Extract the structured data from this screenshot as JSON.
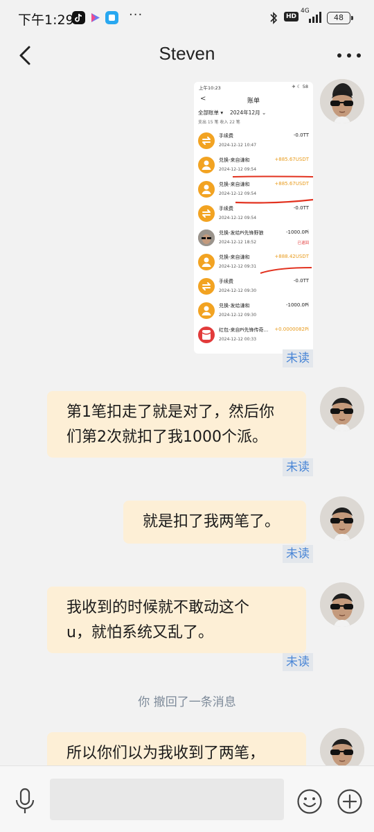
{
  "status_bar": {
    "time": "下午1:29",
    "network": "4G",
    "hd": "HD",
    "battery": "48",
    "more_dots": "···"
  },
  "header": {
    "title": "Steven"
  },
  "messages": [
    {
      "type": "image",
      "status": "未读"
    },
    {
      "type": "text",
      "text_lines": [
        "第1笔扣走了就是对了，然后你",
        "们第2次就扣了我1000个派。"
      ],
      "status": "未读"
    },
    {
      "type": "text",
      "text_lines": [
        "就是扣了我两笔了。"
      ],
      "status": "未读"
    },
    {
      "type": "text",
      "text_lines": [
        "我收到的时候就不敢动这个",
        "u，就怕系统又乱了。"
      ],
      "status": "未读"
    },
    {
      "type": "system",
      "text": "你 撤回了一条消息"
    },
    {
      "type": "text",
      "text_lines": [
        "所以你们以为我收到了两笔，"
      ]
    }
  ],
  "screenshot": {
    "status_time": "上午10:23",
    "status_right": "✈ ☾ 58",
    "back": "<",
    "title": "账单",
    "filter": "全部账单 ▾",
    "month": "2024年12月 ⌄",
    "summary": "支出 15 笔   收入 22 笔",
    "rows": [
      {
        "name": "手续费",
        "date": "2024-12-12 10:47",
        "amount": "-0.0TT",
        "icon": "swap",
        "positive": false
      },
      {
        "name": "兑换-来自谦和",
        "date": "2024-12-12 09:54",
        "amount": "+885.67USDT",
        "icon": "person",
        "positive": true
      },
      {
        "name": "兑换-来自谦和",
        "date": "2024-12-12 09:54",
        "amount": "+885.67USDT",
        "icon": "person",
        "positive": true
      },
      {
        "name": "手续费",
        "date": "2024-12-12 09:54",
        "amount": "-0.0TT",
        "icon": "swap",
        "positive": false
      },
      {
        "name": "兑换-发给Pi先锋野狼",
        "date": "2024-12-12 18:52",
        "amount": "-1000.0Pi",
        "icon": "photo",
        "positive": false,
        "note": "已退回"
      },
      {
        "name": "兑换-来自谦和",
        "date": "2024-12-12 09:31",
        "amount": "+888.42USDT",
        "icon": "person",
        "positive": true
      },
      {
        "name": "手续费",
        "date": "2024-12-12 09:30",
        "amount": "-0.0TT",
        "icon": "swap",
        "positive": false
      },
      {
        "name": "兑换-发给谦和",
        "date": "2024-12-12 09:30",
        "amount": "-1000.0Pi",
        "icon": "person",
        "positive": false
      },
      {
        "name": "红包-来自Pi先锋传奇...",
        "date": "2024-12-12 00:33",
        "amount": "+0.0000082Pi",
        "icon": "redpacket",
        "positive": true
      }
    ]
  },
  "input_bar": {
    "placeholder": ""
  },
  "icons": {
    "back": "chevron-left-icon",
    "more": "more-dots-icon",
    "mic": "microphone-icon",
    "emoji": "smiley-icon",
    "plus": "plus-circle-icon"
  },
  "colors": {
    "bubble": "#fdefd6",
    "unread_text": "#4a86d6",
    "background": "#f2f2f2",
    "accent_orange": "#f2a322"
  }
}
